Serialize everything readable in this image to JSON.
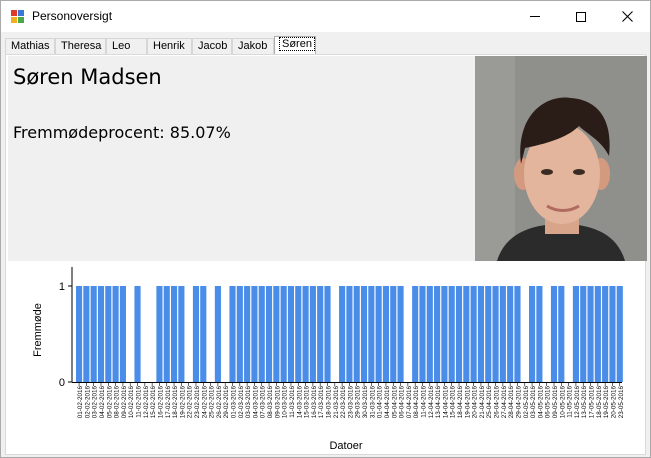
{
  "window": {
    "title": "Personoversigt"
  },
  "tabs": [
    {
      "label": "Mathias"
    },
    {
      "label": "Theresa"
    },
    {
      "label": "Leo"
    },
    {
      "label": "Henrik"
    },
    {
      "label": "Jacob"
    },
    {
      "label": "Jakob"
    },
    {
      "label": "Søren",
      "selected": true
    }
  ],
  "person": {
    "name": "Søren Madsen",
    "attendance": "Fremmødeprocent: 85.07%"
  },
  "colors": {
    "bar": "#4a8de8",
    "window_bg": "#f0f0f0"
  },
  "icons": {
    "app": "app-icon",
    "minimize": "minimize-icon",
    "maximize": "maximize-icon",
    "close": "close-icon"
  },
  "chart_data": {
    "type": "bar",
    "xlabel": "Datoer",
    "ylabel": "Fremmøde",
    "ylim": [
      0,
      1
    ],
    "yticks": [
      "0",
      "1"
    ],
    "categories": [
      "01-02-2016",
      "02-02-2016",
      "03-02-2016",
      "04-02-2016",
      "05-02-2016",
      "08-02-2016",
      "09-02-2016",
      "10-02-2016",
      "11-02-2016",
      "12-02-2016",
      "15-02-2016",
      "16-02-2016",
      "17-02-2016",
      "18-02-2016",
      "19-02-2016",
      "22-02-2016",
      "23-02-2016",
      "24-02-2016",
      "25-02-2016",
      "26-02-2016",
      "29-02-2016",
      "01-03-2016",
      "02-03-2016",
      "03-03-2016",
      "04-03-2016",
      "07-03-2016",
      "08-03-2016",
      "09-03-2016",
      "10-03-2016",
      "11-03-2016",
      "14-03-2016",
      "15-03-2016",
      "16-03-2016",
      "17-03-2016",
      "18-03-2016",
      "21-03-2016",
      "22-03-2016",
      "23-03-2016",
      "29-03-2016",
      "30-03-2016",
      "31-03-2016",
      "01-04-2016",
      "04-04-2016",
      "05-04-2016",
      "06-04-2016",
      "07-04-2016",
      "08-04-2016",
      "11-04-2016",
      "12-04-2016",
      "13-04-2016",
      "14-04-2016",
      "15-04-2016",
      "18-04-2016",
      "19-04-2016",
      "20-04-2016",
      "21-04-2016",
      "25-04-2016",
      "26-04-2016",
      "27-04-2016",
      "28-04-2016",
      "29-04-2016",
      "02-05-2016",
      "03-05-2016",
      "04-05-2016",
      "06-05-2016",
      "09-05-2016",
      "10-05-2016",
      "11-05-2016",
      "12-05-2016",
      "13-05-2016",
      "17-05-2016",
      "18-05-2016",
      "19-05-2016",
      "20-05-2016",
      "23-05-2016"
    ],
    "values": [
      1,
      1,
      1,
      1,
      1,
      1,
      1,
      0,
      1,
      0,
      0,
      1,
      1,
      1,
      1,
      0,
      1,
      1,
      0,
      1,
      0,
      1,
      1,
      1,
      1,
      1,
      1,
      1,
      1,
      1,
      1,
      1,
      1,
      1,
      1,
      0,
      1,
      1,
      1,
      1,
      1,
      1,
      1,
      1,
      1,
      0,
      1,
      1,
      1,
      1,
      1,
      1,
      1,
      1,
      1,
      1,
      1,
      1,
      1,
      1,
      1,
      0,
      1,
      1,
      0,
      1,
      1,
      0,
      1,
      1,
      1,
      1,
      1,
      1,
      1
    ]
  }
}
